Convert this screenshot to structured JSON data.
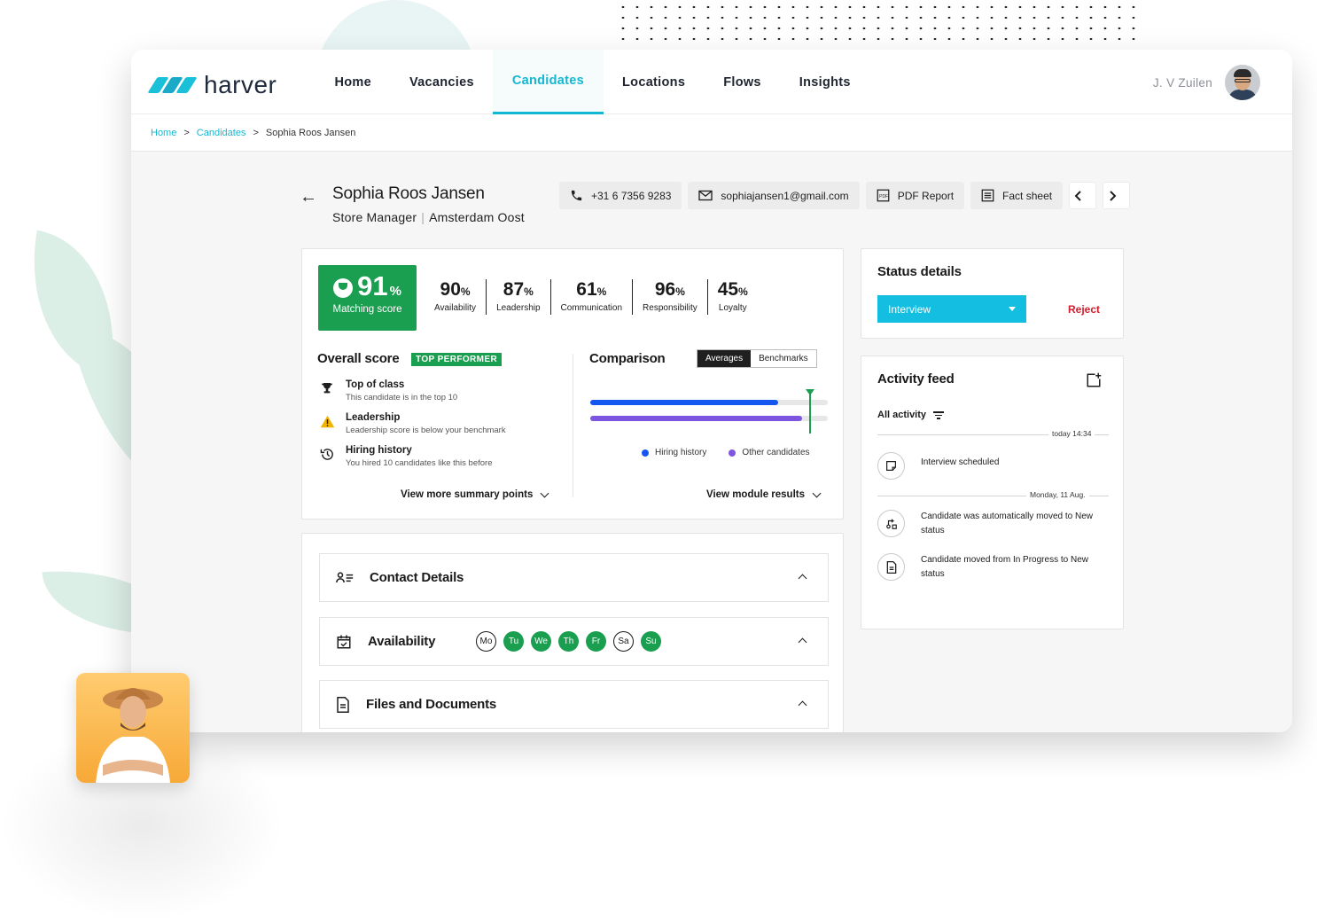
{
  "brand": {
    "name": "harver",
    "accent": "#14b7d2",
    "green": "#1a9e50"
  },
  "nav": {
    "items": [
      {
        "label": "Home"
      },
      {
        "label": "Vacancies"
      },
      {
        "label": "Candidates",
        "active": true
      },
      {
        "label": "Locations"
      },
      {
        "label": "Flows"
      },
      {
        "label": "Insights"
      }
    ],
    "user_name": "J. V Zuilen"
  },
  "breadcrumb": {
    "home": "Home",
    "section": "Candidates",
    "current": "Sophia Roos Jansen",
    "separator": ">"
  },
  "candidate": {
    "name": "Sophia Roos Jansen",
    "role": "Store Manager",
    "location": "Amsterdam Oost",
    "phone": "+31 6 7356 9283",
    "email": "sophiajansen1@gmail.com",
    "pdf_label": "PDF Report",
    "fact_label": "Fact sheet"
  },
  "scores": {
    "matching": {
      "value": "91",
      "unit": "%",
      "label": "Matching score"
    },
    "metrics": [
      {
        "value": "90",
        "unit": "%",
        "label": "Availability"
      },
      {
        "value": "87",
        "unit": "%",
        "label": "Leadership"
      },
      {
        "value": "61",
        "unit": "%",
        "label": "Communication"
      },
      {
        "value": "96",
        "unit": "%",
        "label": "Responsibility"
      },
      {
        "value": "45",
        "unit": "%",
        "label": "Loyalty"
      }
    ]
  },
  "overall": {
    "title": "Overall score",
    "badge": "TOP PERFORMER",
    "items": [
      {
        "icon": "trophy-icon",
        "title": "Top of class",
        "desc": "This candidate is in the top 10"
      },
      {
        "icon": "warning-icon",
        "title": "Leadership",
        "desc": "Leadership score is below your benchmark"
      },
      {
        "icon": "history-icon",
        "title": "Hiring history",
        "desc": "You hired 10 candidates like this before"
      }
    ],
    "more_label": "View more summary points"
  },
  "comparison": {
    "title": "Comparison",
    "toggle": [
      "Averages",
      "Benchmarks"
    ],
    "bars": [
      {
        "name": "Hiring history",
        "color": "#1457f0",
        "fraction": 0.79
      },
      {
        "name": "Other candidates",
        "color": "#7e55e0",
        "fraction": 0.89
      }
    ],
    "benchmark_fraction": 0.92,
    "more_label": "View module results"
  },
  "sections": {
    "contact": "Contact Details",
    "availability": "Availability",
    "files": "Files and Documents",
    "days": [
      {
        "label": "Mo",
        "on": false
      },
      {
        "label": "Tu",
        "on": true
      },
      {
        "label": "We",
        "on": true
      },
      {
        "label": "Th",
        "on": true
      },
      {
        "label": "Fr",
        "on": true
      },
      {
        "label": "Sa",
        "on": false
      },
      {
        "label": "Su",
        "on": true
      }
    ]
  },
  "status": {
    "title": "Status details",
    "value": "Interview",
    "reject": "Reject"
  },
  "feed": {
    "title": "Activity feed",
    "filter": "All activity",
    "date1": "today 14:34",
    "item1": "Interview scheduled",
    "date2": "Monday, 11 Aug.",
    "item2": "Candidate was automatically moved to New status",
    "item3": "Candidate moved from In Progress to New status"
  }
}
